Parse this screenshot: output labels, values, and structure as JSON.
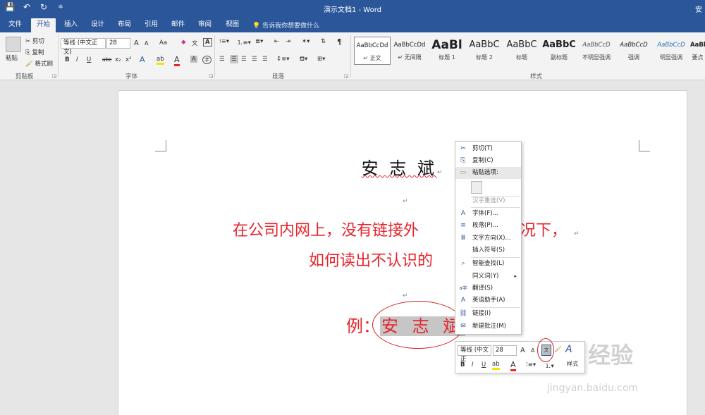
{
  "titlebar": {
    "title": "演示文档1 - Word",
    "right_text": "安",
    "qat": {
      "save_icon": "save-icon",
      "undo_icon": "undo-icon",
      "redo_icon": "redo-icon",
      "customize_icon": "customize-icon"
    }
  },
  "tabs": [
    "文件",
    "开始",
    "插入",
    "设计",
    "布局",
    "引用",
    "邮件",
    "审阅",
    "视图"
  ],
  "active_tab": "开始",
  "tell_me": "告诉我你想要做什么",
  "clipboard": {
    "paste": "粘贴",
    "cut": "剪切",
    "copy": "复制",
    "format_painter": "格式刷",
    "label": "剪贴板"
  },
  "font_group": {
    "font_name": "等线 (中文正文)",
    "font_size": "28",
    "grow": "A",
    "shrink": "A",
    "change_case": "Aa",
    "bold": "B",
    "italic": "I",
    "underline": "U",
    "strike": "abc",
    "subscript": "x₂",
    "superscript": "x²",
    "label": "字体"
  },
  "paragraph_group": {
    "label": "段落"
  },
  "styles_group": {
    "label": "样式",
    "items": [
      {
        "sample": "AaBbCcDd",
        "name": "↵ 正文"
      },
      {
        "sample": "AaBbCcDd",
        "name": "↵ 无间隔"
      },
      {
        "sample": "AaBl",
        "name": "标题 1"
      },
      {
        "sample": "AaBbC",
        "name": "标题 2"
      },
      {
        "sample": "AaBbC",
        "name": "标题"
      },
      {
        "sample": "AaBbC",
        "name": "副标题"
      },
      {
        "sample": "AaBbCcD",
        "name": "不明显强调"
      },
      {
        "sample": "AaBbCcD",
        "name": "强调"
      },
      {
        "sample": "AaBbCcD",
        "name": "明显强调"
      },
      {
        "sample": "AaBbCcD",
        "name": "要点"
      }
    ]
  },
  "document": {
    "title_line": "安 志 斌",
    "line1": "在公司内网上，没有链接外",
    "line1_tail": "况下，",
    "line2": "如何读出不认识的",
    "example_prefix": "例：",
    "example_selected": "安 志 斌",
    "para_mark": "↵"
  },
  "context_menu": {
    "items": [
      {
        "icon": "scissors-icon",
        "glyph": "✂",
        "label": "剪切(T)"
      },
      {
        "icon": "copy-icon",
        "glyph": "⎘",
        "label": "复制(C)"
      },
      {
        "icon": "paste-icon",
        "glyph": "📋",
        "label": "粘贴选项:"
      },
      {
        "icon": "",
        "glyph": "",
        "label": "汉字重选(V)"
      },
      {
        "icon": "font-icon",
        "glyph": "A",
        "label": "字体(F)..."
      },
      {
        "icon": "paragraph-icon",
        "glyph": "≡",
        "label": "段落(P)..."
      },
      {
        "icon": "text-direction-icon",
        "glyph": "Ⅲ",
        "label": "文字方向(X)..."
      },
      {
        "icon": "",
        "glyph": "",
        "label": "插入符号(S)"
      },
      {
        "icon": "smart-lookup-icon",
        "glyph": "🔍",
        "label": "智能查找(L)"
      },
      {
        "icon": "",
        "glyph": "",
        "label": "同义词(Y)"
      },
      {
        "icon": "translate-icon",
        "glyph": "a字",
        "label": "翻译(S)"
      },
      {
        "icon": "english-assistant-icon",
        "glyph": "A",
        "label": "英语助手(A)"
      },
      {
        "icon": "link-icon",
        "glyph": "🔗",
        "label": "链接(I)"
      },
      {
        "icon": "comment-icon",
        "glyph": "💬",
        "label": "新建批注(M)"
      }
    ]
  },
  "mini_toolbar": {
    "font_name": "等线 (中文正",
    "font_size": "28",
    "styles_label": "样式",
    "phonetic_icon": "phonetic-guide-icon"
  },
  "watermark": {
    "logo": "Bai 经验",
    "url": "jingyan.baidu.com"
  },
  "colors": {
    "brand": "#2b579a",
    "doc_text_red": "#e8242c",
    "selection": "#c6c6c6",
    "annotation_red": "#d81e1e"
  }
}
